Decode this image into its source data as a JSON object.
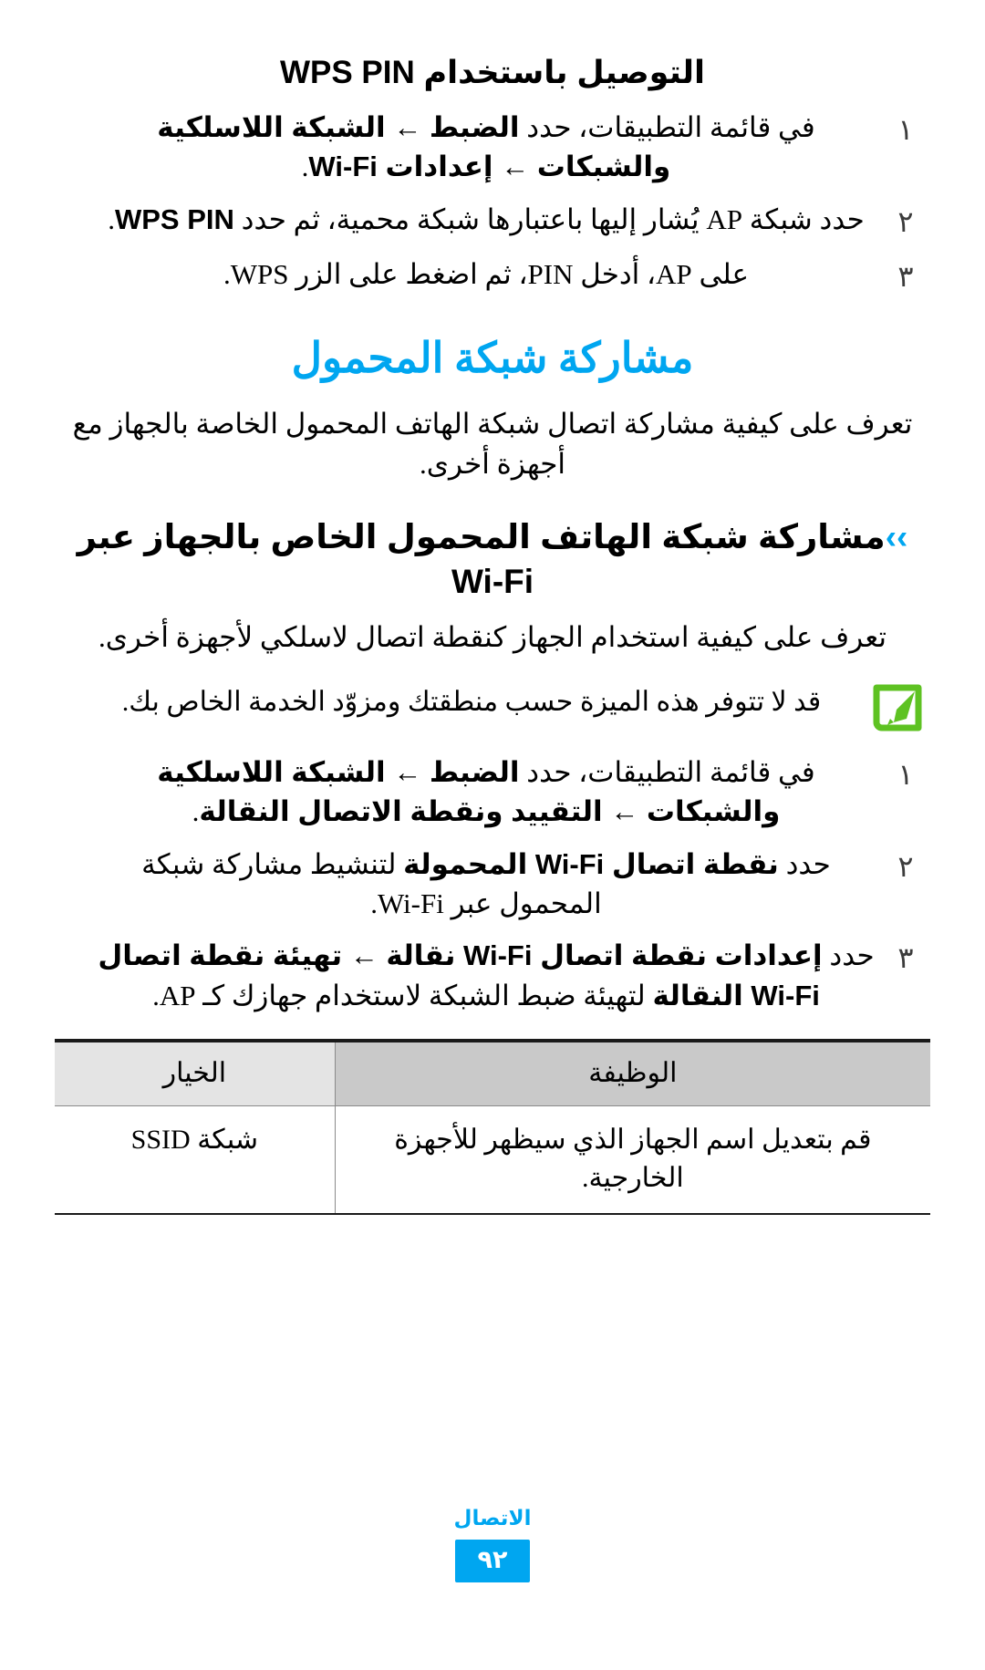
{
  "colors": {
    "accent_blue": "#00a6f0",
    "note_green": "#5ec222",
    "table_header_bg": "#c9c9c9",
    "table_option_header_bg": "#e4e4e4",
    "text": "#000000"
  },
  "wps_section": {
    "heading": "التوصيل باستخدام WPS PIN",
    "steps": [
      {
        "number": "١",
        "text_parts": [
          {
            "t": "في قائمة التطبيقات، حدد ",
            "bold": false
          },
          {
            "t": "الضبط",
            "bold": true
          },
          {
            "t": " ← ",
            "bold": true
          },
          {
            "t": "الشبكة اللاسلكية والشبكات",
            "bold": true
          },
          {
            "t": " ← ",
            "bold": true
          },
          {
            "t": "إعدادات Wi-Fi",
            "bold": true
          },
          {
            "t": ".",
            "bold": false
          }
        ]
      },
      {
        "number": "٢",
        "text_parts": [
          {
            "t": "حدد شبكة AP يُشار إليها باعتبارها شبكة محمية، ثم حدد ",
            "bold": false
          },
          {
            "t": "WPS PIN",
            "bold": true
          },
          {
            "t": ".",
            "bold": false
          }
        ]
      },
      {
        "number": "٣",
        "text_parts": [
          {
            "t": "على AP، أدخل PIN، ثم اضغط على الزر WPS.",
            "bold": false
          }
        ]
      }
    ]
  },
  "mobile_share_section": {
    "heading": "مشاركة شبكة المحمول",
    "intro": "تعرف على كيفية مشاركة اتصال شبكة الهاتف المحمول الخاصة بالجهاز مع أجهزة أخرى.",
    "subsection": {
      "chevron": "››",
      "heading": "مشاركة شبكة الهاتف المحمول الخاص بالجهاز عبر Wi-Fi",
      "intro": "تعرف على كيفية استخدام الجهاز كنقطة اتصال لاسلكي لأجهزة أخرى.",
      "note": {
        "icon": "note-pencil-icon",
        "text": "قد لا تتوفر هذه الميزة حسب منطقتك ومزوّد الخدمة الخاص بك."
      },
      "steps": [
        {
          "number": "١",
          "text_parts": [
            {
              "t": "في قائمة التطبيقات، حدد ",
              "bold": false
            },
            {
              "t": "الضبط",
              "bold": true
            },
            {
              "t": " ← ",
              "bold": true
            },
            {
              "t": "الشبكة اللاسلكية والشبكات",
              "bold": true
            },
            {
              "t": " ← ",
              "bold": true
            },
            {
              "t": "التقييد ونقطة الاتصال النقالة",
              "bold": true
            },
            {
              "t": ".",
              "bold": false
            }
          ]
        },
        {
          "number": "٢",
          "text_parts": [
            {
              "t": "حدد ",
              "bold": false
            },
            {
              "t": "نقطة اتصال Wi-Fi المحمولة",
              "bold": true
            },
            {
              "t": " لتنشيط مشاركة شبكة المحمول عبر Wi-Fi.",
              "bold": false
            }
          ]
        },
        {
          "number": "٣",
          "text_parts": [
            {
              "t": "حدد ",
              "bold": false
            },
            {
              "t": "إعدادات نقطة اتصال Wi-Fi نقالة",
              "bold": true
            },
            {
              "t": " ← ",
              "bold": true
            },
            {
              "t": "تهيئة نقطة اتصال Wi-Fi النقالة",
              "bold": true
            },
            {
              "t": " لتهيئة ضبط الشبكة لاستخدام جهازك كـ AP.",
              "bold": false
            }
          ]
        }
      ]
    }
  },
  "options_table": {
    "headers": {
      "option": "الخيار",
      "function": "الوظيفة"
    },
    "rows": [
      {
        "option": "شبكة SSID",
        "function": "قم بتعديل اسم الجهاز الذي سيظهر للأجهزة الخارجية."
      }
    ]
  },
  "footer": {
    "label": "الاتصال",
    "page_number": "٩٢"
  }
}
